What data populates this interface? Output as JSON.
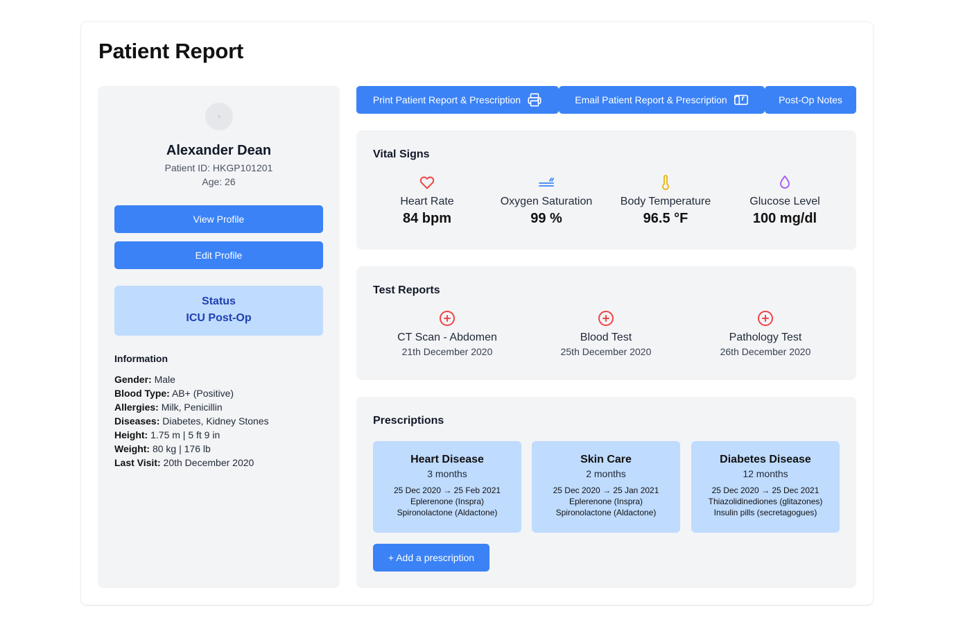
{
  "page": {
    "title": "Patient Report"
  },
  "patient": {
    "name": "Alexander Dean",
    "id_text": "Patient ID: HKGP101201",
    "age_text": "Age: 26",
    "view_profile_label": "View Profile",
    "edit_profile_label": "Edit Profile",
    "status_label": "Status",
    "status_value": "ICU Post-Op"
  },
  "information": {
    "title": "Information",
    "rows": [
      {
        "label": "Gender:",
        "value": "Male"
      },
      {
        "label": "Blood Type:",
        "value": "AB+ (Positive)"
      },
      {
        "label": "Allergies:",
        "value": "Milk, Penicillin"
      },
      {
        "label": "Diseases:",
        "value": "Diabetes, Kidney Stones"
      },
      {
        "label": "Height:",
        "value": "1.75 m | 5 ft 9 in"
      },
      {
        "label": "Weight:",
        "value": "80 kg | 176 lb"
      },
      {
        "label": "Last Visit:",
        "value": "20th December 2020"
      }
    ]
  },
  "actions": {
    "print_label": "Print Patient Report & Prescription",
    "print_icon": "printer-icon",
    "email_label": "Email Patient Report & Prescription",
    "email_icon": "mailbox-icon",
    "notes_label": "Post-Op Notes"
  },
  "vitals": {
    "title": "Vital Signs",
    "items": [
      {
        "label": "Heart Rate",
        "value": "84 bpm",
        "icon": "heart-icon",
        "color": "#ef4444"
      },
      {
        "label": "Oxygen Saturation",
        "value": "99 %",
        "icon": "oxygen-icon",
        "color": "#3b82f6"
      },
      {
        "label": "Body Temperature",
        "value": "96.5 °F",
        "icon": "thermometer-icon",
        "color": "#eab308"
      },
      {
        "label": "Glucose Level",
        "value": "100 mg/dl",
        "icon": "droplet-icon",
        "color": "#a855f7"
      }
    ]
  },
  "tests": {
    "title": "Test Reports",
    "items": [
      {
        "name": "CT Scan - Abdomen",
        "date": "21th December 2020",
        "icon": "plus-circle-icon"
      },
      {
        "name": "Blood Test",
        "date": "25th December 2020",
        "icon": "plus-circle-icon"
      },
      {
        "name": "Pathology Test",
        "date": "26th December 2020",
        "icon": "plus-circle-icon"
      }
    ],
    "icon_color": "#ef4444"
  },
  "prescriptions": {
    "title": "Prescriptions",
    "items": [
      {
        "name": "Heart Disease",
        "duration": "3 months",
        "dates": "25 Dec 2020 → 25 Feb 2021",
        "med1": "Eplerenone (Inspra)",
        "med2": "Spironolactone (Aldactone)"
      },
      {
        "name": "Skin Care",
        "duration": "2 months",
        "dates": "25 Dec 2020 → 25 Jan 2021",
        "med1": "Eplerenone (Inspra)",
        "med2": "Spironolactone (Aldactone)"
      },
      {
        "name": "Diabetes Disease",
        "duration": "12 months",
        "dates": "25 Dec 2020 → 25 Dec 2021",
        "med1": "Thiazolidinediones (glitazones)",
        "med2": "Insulin pills (secretagogues)"
      }
    ],
    "add_label": "+ Add a prescription"
  },
  "colors": {
    "accent": "#3b82f6",
    "status_bg": "#bfdbfe",
    "status_text": "#1e40af",
    "panel_bg": "#f3f4f6"
  }
}
